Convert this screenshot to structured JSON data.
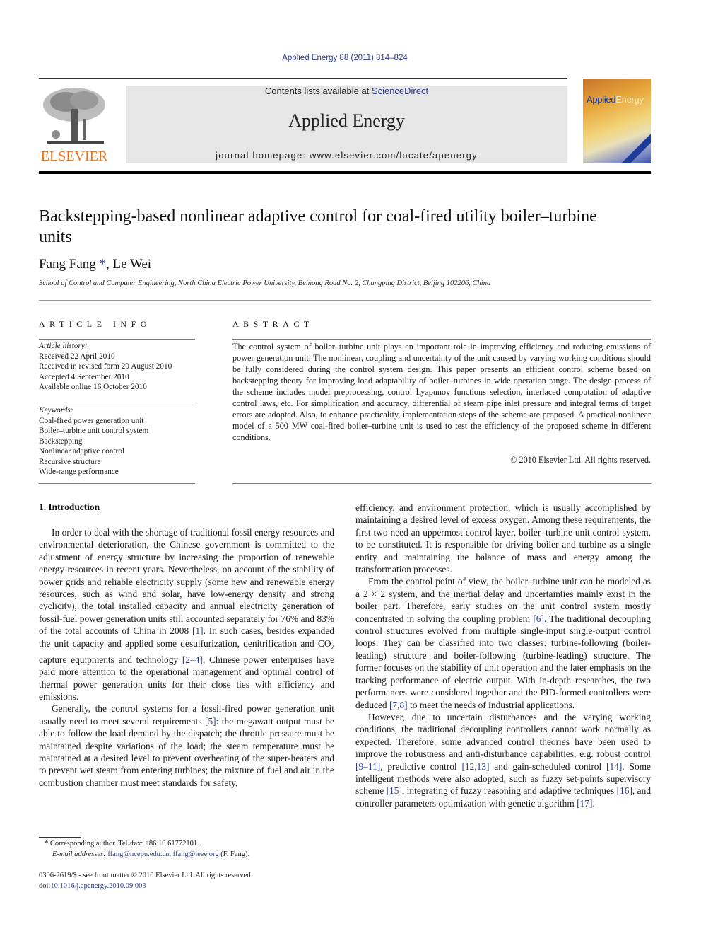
{
  "journal_ref": "Applied Energy 88 (2011) 814–824",
  "header": {
    "publisher_logo_text": "ELSEVIER",
    "contents_prefix": "Contents lists available at ",
    "contents_link": "ScienceDirect",
    "journal_title": "Applied Energy",
    "homepage": "journal homepage: www.elsevier.com/locate/apenergy",
    "cover_title_a": "Applied",
    "cover_title_b": "Energy"
  },
  "article": {
    "title": "Backstepping-based nonlinear adaptive control for coal-fired utility boiler–turbine units",
    "author1": "Fang Fang",
    "author1_mark": "*",
    "author_sep": ", ",
    "author2": "Le Wei",
    "affiliation": "School of Control and Computer Engineering, North China Electric Power University, Beinong Road No. 2, Changping District, Beijing 102206, China"
  },
  "article_info": {
    "label": "ARTICLE INFO",
    "history_label": "Article history:",
    "history": [
      "Received 22 April 2010",
      "Received in revised form 29 August 2010",
      "Accepted 4 September 2010",
      "Available online 16 October 2010"
    ],
    "keywords_label": "Keywords:",
    "keywords": [
      "Coal-fired power generation unit",
      "Boiler–turbine unit control system",
      "Backstepping",
      "Nonlinear adaptive control",
      "Recursive structure",
      "Wide-range performance"
    ]
  },
  "abstract": {
    "label": "ABSTRACT",
    "text": "The control system of boiler–turbine unit plays an important role in improving efficiency and reducing emissions of power generation unit. The nonlinear, coupling and uncertainty of the unit caused by varying working conditions should be fully considered during the control system design. This paper presents an efficient control scheme based on backstepping theory for improving load adaptability of boiler–turbines in wide operation range. The design process of the scheme includes model preprocessing, control Lyapunov functions selection, interlaced computation of adaptive control laws, etc. For simplification and accuracy, differential of steam pipe inlet pressure and integral terms of target errors are adopted. Also, to enhance practicality, implementation steps of the scheme are proposed. A practical nonlinear model of a 500 MW coal-fired boiler–turbine unit is used to test the efficiency of the proposed scheme in different conditions.",
    "copyright": "© 2010 Elsevier Ltd. All rights reserved."
  },
  "intro": {
    "heading": "1. Introduction",
    "p1": {
      "a": "In order to deal with the shortage of traditional fossil energy resources and environmental deterioration, the Chinese government is committed to the adjustment of energy structure by increasing the proportion of renewable energy resources in recent years. Nevertheless, on account of the stability of power grids and reliable electricity supply (some new and renewable energy resources, such as wind and solar, have low-energy density and strong cyclicity), the total installed capacity and annual electricity generation of fossil-fuel power generation units still accounted separately for 76% and 83% of the total accounts of China in 2008 ",
      "ref1": "[1]",
      "b": ". In such cases, besides expanded the unit capacity and applied some desulfurization, denitrification and CO",
      "sub": "2",
      "c": " capture equipments and technology ",
      "ref2": "[2–4]",
      "d": ", Chinese power enterprises have paid more attention to the operational management and optimal control of thermal power generation units for their close ties with efficiency and emissions."
    },
    "p2": {
      "a": "Generally, the control systems for a fossil-fired power generation unit usually need to meet several requirements ",
      "ref1": "[5]",
      "b": ": the megawatt output must be able to follow the load demand by the dispatch; the throttle pressure must be maintained despite variations of the load; the steam temperature must be maintained at a desired level to prevent overheating of the super-heaters and to prevent wet steam from entering turbines; the mixture of fuel and air in the combustion chamber must meet standards for safety,"
    },
    "p2_cont": "efficiency, and environment protection, which is usually accomplished by maintaining a desired level of excess oxygen. Among these requirements, the first two need an uppermost control layer, boiler–turbine unit control system, to be constituted. It is responsible for driving boiler and turbine as a single entity and maintaining the balance of mass and energy among the transformation processes.",
    "p3": {
      "a": "From the control point of view, the boiler–turbine unit can be modeled as a 2 × 2 system, and the inertial delay and uncertainties mainly exist in the boiler part. Therefore, early studies on the unit control system mostly concentrated in solving the coupling problem ",
      "ref1": "[6]",
      "b": ". The traditional decoupling control structures evolved from multiple single-input single-output control loops. They can be classified into two classes: turbine-following (boiler-leading) structure and boiler-following (turbine-leading) structure. The former focuses on the stability of unit operation and the later emphasis on the tracking performance of electric output. With in-depth researches, the two performances were considered together and the PID-formed controllers were deduced ",
      "ref2": "[7,8]",
      "c": " to meet the needs of industrial applications."
    },
    "p4": {
      "a": "However, due to uncertain disturbances and the varying working conditions, the traditional decoupling controllers cannot work normally as expected. Therefore, some advanced control theories have been used to improve the robustness and anti-disturbance capabilities, e.g. robust control ",
      "ref1": "[9–11]",
      "b": ", predictive control ",
      "ref2": "[12,13]",
      "c": " and gain-scheduled control ",
      "ref3": "[14]",
      "d": ". Some intelligent methods were also adopted, such as fuzzy set-points supervisory scheme ",
      "ref4": "[15]",
      "e": ", integrating of fuzzy reasoning and adaptive techniques ",
      "ref5": "[16]",
      "f": ", and controller parameters optimization with genetic algorithm ",
      "ref6": "[17]",
      "g": "."
    }
  },
  "footnote": {
    "mark": "*",
    "corresponding": " Corresponding author. Tel./fax: +86 10 61772101.",
    "email_label": "E-mail addresses: ",
    "email1": "ffang@ncepu.edu.cn",
    "email_sep": ", ",
    "email2": "ffang@ieee.org",
    "email_suffix": " (F. Fang)."
  },
  "front_matter": {
    "issn_line": "0306-2619/$ - see front matter © 2010 Elsevier Ltd. All rights reserved.",
    "doi_prefix": "doi:",
    "doi": "10.1016/j.apenergy.2010.09.003"
  },
  "colors": {
    "link": "#2a3a8c",
    "elsevier_orange": "#e8731f",
    "header_box": "#e6e6e6"
  }
}
